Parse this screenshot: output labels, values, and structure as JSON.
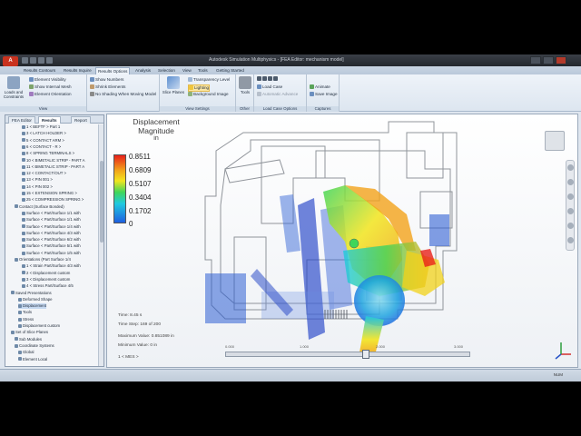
{
  "window": {
    "title": "Autodesk Simulation Multiphysics - [FEA Editor: mechanism model]"
  },
  "ribbon": {
    "tabs": [
      "Results Contours",
      "Results Inquire",
      "Results Options",
      "Analysis",
      "Selection",
      "View",
      "Tools",
      "Getting Started"
    ],
    "active_tab": "Results Options",
    "groups": {
      "loads": {
        "big_label": "Loads and Constraints",
        "items": [
          "Element Visibility",
          "Show Internal Mesh",
          "Element Orientation"
        ],
        "label": "View"
      },
      "numbers": {
        "items": [
          "Show Numbers",
          "Shrink Elements",
          "No Shading When Moving Model"
        ]
      },
      "view_settings": {
        "big_label": "Slice Planes",
        "items": [
          "Transparency Level",
          "Lighting",
          "Background Image"
        ],
        "label": "View Settings"
      },
      "other": {
        "big_label": "Tools",
        "label": "Other"
      },
      "load_case": {
        "items": [
          "Load Case",
          "Automatic Advance"
        ],
        "label": "Load Case Options"
      },
      "captures": {
        "items": [
          "Animate",
          "Save Image"
        ],
        "label": "Captures"
      }
    }
  },
  "browser": {
    "tabs": [
      "FEA Editor",
      "Results",
      "Report"
    ],
    "active_tab": "Results",
    "nodes": [
      "1 < BEFTF > Part 1",
      "3 < LATCH HOLDER >",
      "5 < CONTACT ARM >",
      "6 < CONTACT - R >",
      "8 < SPRING TERMINALS >",
      "10 < BIMETALIC STRIP - PART A",
      "11 < BIMETALIC STRIP - PART A",
      "12 < CONTACT/OUT >",
      "13 < PIN 001 >",
      "14 < PIN 002 >",
      "15 < EXTENSION SPRING >",
      "25 < COMPRESSION SPRING >",
      "Contact (Surface Bonded)",
      "Surface < Part/Surface 1/1 with",
      "Surface < Part/Surface 1/1 with",
      "Surface < Part/Surface 1/4 with",
      "Surface < Part/Surface 4/3 with",
      "Surface < Part/Surface 6/2 with",
      "Surface < Part/Surface 5/1 with",
      "Surface < Part/Surface 1/5 with",
      "Orientations (Part Surface 1/4",
      "1 < Strain Part/Surface 4/3 with",
      "2 < Displacement custom",
      "3 < Displacement custom",
      "4 < Stress Part/Surface 4/5",
      "Saved Presentations",
      "Deformed Shape",
      "Displacement",
      "Tools",
      "Stress",
      "Displacement custom",
      "Set of Slice Planes",
      "Sub Modules",
      "Coordinate Systems",
      "Global",
      "Element Local"
    ],
    "selected_index": 27
  },
  "viewport": {
    "title": "Displacement Magnitude",
    "unit": "in",
    "legend_values": [
      "0.8511",
      "0.6809",
      "0.5107",
      "0.3404",
      "0.1702",
      "0"
    ],
    "time": "Time: 8.45 s",
    "time_step": "Time Step: 169 of 200",
    "max_value": "Maximum Value: 0.851089 in",
    "min_value": "Minimum Value: 0 in",
    "mes_tag": "1 < MES >",
    "timeline_labels": [
      "0.000",
      "1.000",
      "2.000",
      "3.000"
    ]
  },
  "status": {
    "right": "NUM"
  }
}
